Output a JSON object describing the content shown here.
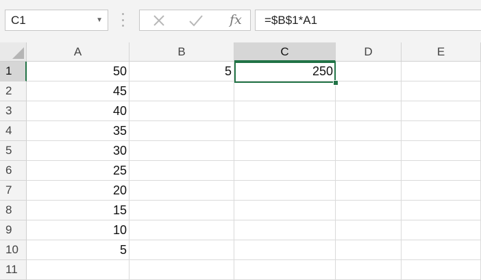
{
  "formula_bar": {
    "name_box": "C1",
    "formula": "=$B$1*A1",
    "fx_label": "fx"
  },
  "columns": [
    "A",
    "B",
    "C",
    "D",
    "E"
  ],
  "selected_column": "C",
  "rows": [
    "1",
    "2",
    "3",
    "4",
    "5",
    "6",
    "7",
    "8",
    "9",
    "10",
    "11"
  ],
  "selected_row": "1",
  "cells": {
    "A": [
      "50",
      "45",
      "40",
      "35",
      "30",
      "25",
      "20",
      "15",
      "10",
      "5",
      ""
    ],
    "B": [
      "5",
      "",
      "",
      "",
      "",
      "",
      "",
      "",
      "",
      "",
      ""
    ],
    "C": [
      "250",
      "",
      "",
      "",
      "",
      "",
      "",
      "",
      "",
      "",
      ""
    ],
    "D": [
      "",
      "",
      "",
      "",
      "",
      "",
      "",
      "",
      "",
      "",
      ""
    ],
    "E": [
      "",
      "",
      "",
      "",
      "",
      "",
      "",
      "",
      "",
      "",
      ""
    ]
  },
  "active_cell": "C1",
  "colors": {
    "accent": "#217346"
  },
  "icons": {
    "cancel": "close-icon",
    "enter": "checkmark-icon",
    "insert_function": "fx-icon"
  }
}
